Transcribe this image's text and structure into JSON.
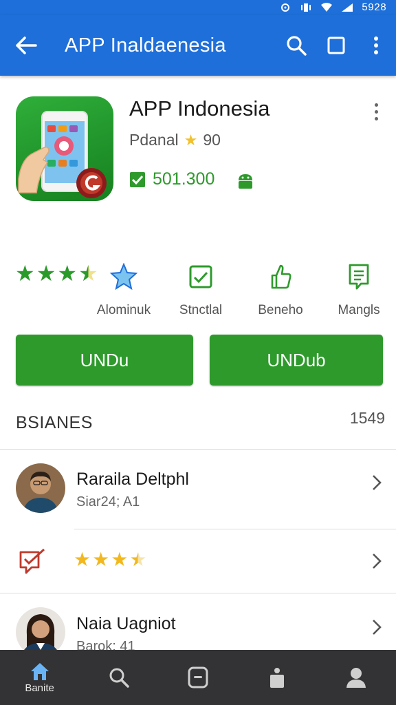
{
  "status_bar": {
    "time": "5928",
    "icons": [
      "nfc-icon",
      "vibrate-icon",
      "wifi-icon",
      "signal-icon"
    ]
  },
  "app_bar": {
    "title": "APP Inaldaenesia",
    "icons": [
      "back-arrow-icon",
      "search-icon",
      "square-icon",
      "more-vert-icon"
    ]
  },
  "app": {
    "name": "APP Indonesia",
    "developer": "Pdanal",
    "rating": "90",
    "installs": "501.300",
    "icon": "phone-hand-icon"
  },
  "stats": {
    "stars": 3.5,
    "items": [
      {
        "label": "Alominuk",
        "icon": "star-badge-icon"
      },
      {
        "label": "Stnctlal",
        "icon": "checkbox-icon"
      },
      {
        "label": "Beneho",
        "icon": "thumb-up-icon"
      },
      {
        "label": "Mangls",
        "icon": "document-icon"
      }
    ]
  },
  "buttons": {
    "left": "UNDu",
    "right": "UNDub"
  },
  "section": {
    "title": "BSIANES",
    "count": "1549"
  },
  "list": [
    {
      "name": "Raraila Deltphl",
      "sub": "Siar24; A1"
    },
    {
      "stars": 3.5,
      "icon": "review-check-icon"
    },
    {
      "name": "Naia Uagniot",
      "sub": "Barok: 41"
    }
  ],
  "bottom_nav": {
    "home_label": "Banite",
    "icons": [
      "home-icon",
      "search-icon",
      "apps-icon",
      "bag-icon",
      "person-icon"
    ]
  },
  "colors": {
    "primary": "#1e6fd9",
    "green": "#2e9a2c",
    "star_yellow": "#f2c12e",
    "star_green": "#2a9a2a",
    "nav": "#333335"
  }
}
